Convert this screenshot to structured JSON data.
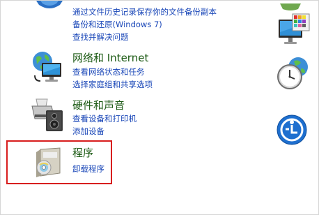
{
  "system_security": {
    "links": [
      "通过文件历史记录保存你的文件备份副本",
      "备份和还原(Windows 7)",
      "查找并解决问题"
    ]
  },
  "network": {
    "title": "网络和 Internet",
    "links": [
      "查看网络状态和任务",
      "选择家庭组和共享选项"
    ]
  },
  "hardware": {
    "title": "硬件和声音",
    "links": [
      "查看设备和打印机",
      "添加设备"
    ]
  },
  "programs": {
    "title": "程序",
    "links": [
      "卸载程序"
    ]
  },
  "icons": {
    "system_security": "shield-icon",
    "network": "globe-monitor-icon",
    "hardware": "printer-speaker-icon",
    "programs": "software-box-icon",
    "appearance": "monitor-palette-icon",
    "clock_region": "clock-globe-icon",
    "ease_of_access": "ease-of-access-icon",
    "user_accounts": "user-accounts-icon"
  },
  "colors": {
    "title": "#1c5a14",
    "link": "#1a47b8",
    "highlight": "#d81e1e"
  }
}
